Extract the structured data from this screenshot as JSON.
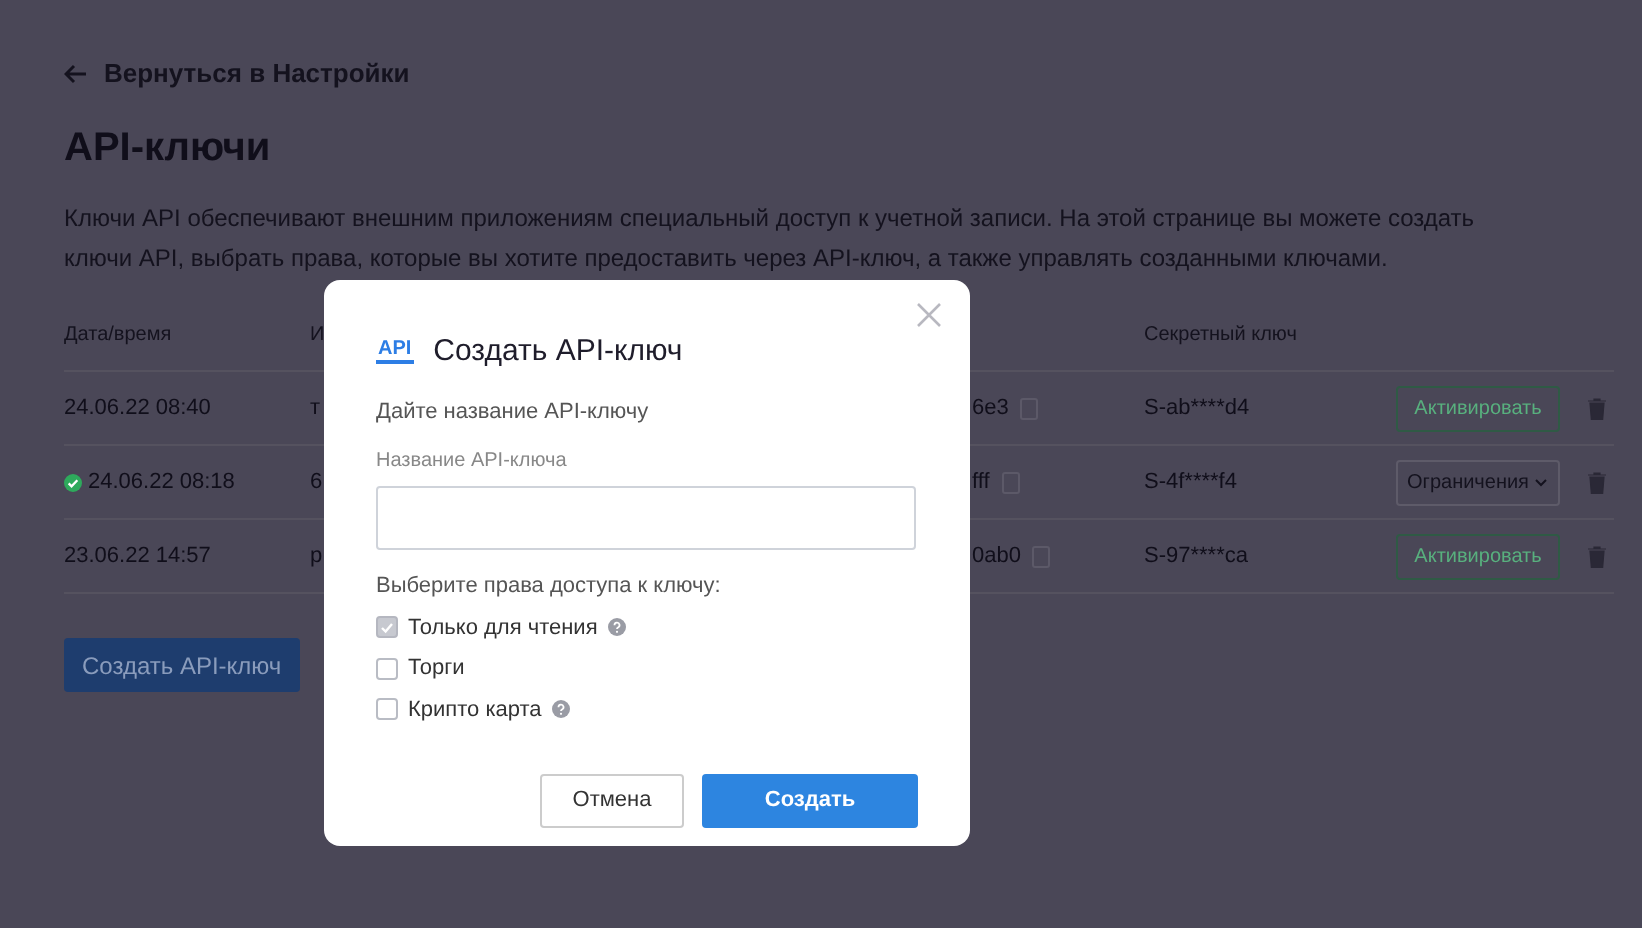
{
  "back_link": "Вернуться в Настройки",
  "title": "API-ключи",
  "description": "Ключи API обеспечивают внешним приложениям специальный доступ к учетной записи. На этой странице вы можете создать ключи API, выбрать права, которые вы хотите предоставить через API-ключ, а также управлять созданными ключами.",
  "table": {
    "columns": [
      "Дата/время",
      "И",
      "Секретный ключ"
    ],
    "rows": [
      {
        "date": "24.06.22 08:40",
        "active": false,
        "name": "т",
        "key": "6e3",
        "secret": "S-ab****d4",
        "action": {
          "kind": "activate",
          "label": "Активировать"
        }
      },
      {
        "date": "24.06.22 08:18",
        "active": true,
        "name": "6",
        "key": "fff",
        "secret": "S-4f****f4",
        "action": {
          "kind": "restrictions",
          "label": "Ограничения"
        }
      },
      {
        "date": "23.06.22 14:57",
        "active": false,
        "name": "р",
        "key": "0ab0",
        "secret": "S-97****ca",
        "action": {
          "kind": "activate",
          "label": "Активировать"
        }
      }
    ]
  },
  "create_button": "Создать API-ключ",
  "modal": {
    "logo": "API",
    "title": "Создать API-ключ",
    "subtitle": "Дайте название API-ключу",
    "field_label": "Название API-ключа",
    "permissions_label": "Выберите права доступа к ключу:",
    "permissions": [
      {
        "label": "Только для чтения",
        "checked": true,
        "disabled": true,
        "help": true
      },
      {
        "label": "Торги",
        "checked": false,
        "disabled": false,
        "help": false
      },
      {
        "label": "Крипто карта",
        "checked": false,
        "disabled": false,
        "help": true
      }
    ],
    "buttons": [
      {
        "kind": "secondary",
        "label": "Отмена"
      },
      {
        "kind": "primary",
        "label": "Создать"
      }
    ]
  }
}
